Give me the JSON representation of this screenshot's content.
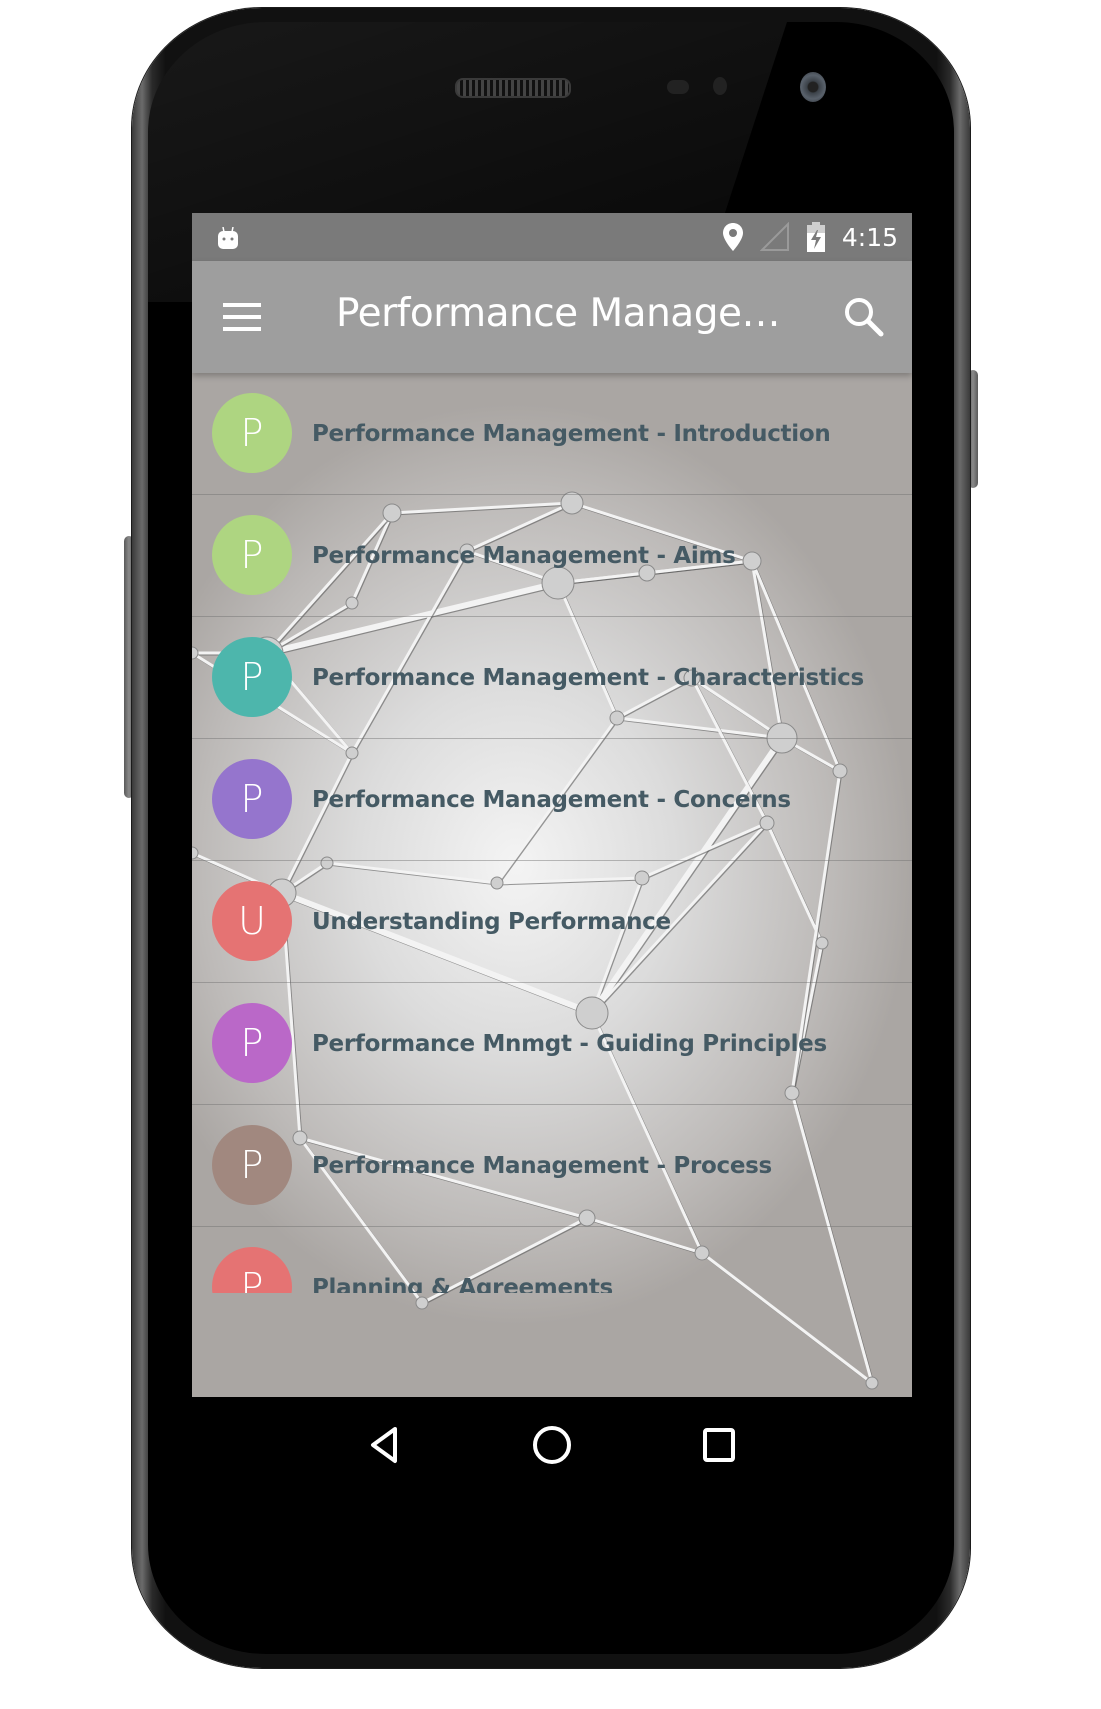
{
  "status_bar": {
    "left_icon": "android-debug-icon",
    "icons": [
      "location-icon",
      "signal-icon",
      "battery-charging-icon"
    ],
    "time": "4:15"
  },
  "toolbar": {
    "menu_icon": "hamburger-menu-icon",
    "title": "Performance Management",
    "search_icon": "search-icon"
  },
  "list": {
    "items": [
      {
        "initial": "P",
        "label": "Performance Management - Introduction",
        "color": "#aed581"
      },
      {
        "initial": "P",
        "label": "Performance Management - Aims",
        "color": "#aed581"
      },
      {
        "initial": "P",
        "label": "Performance Management - Characteristics",
        "color": "#4db6ac"
      },
      {
        "initial": "P",
        "label": "Performance Management - Concerns",
        "color": "#9575cd"
      },
      {
        "initial": "U",
        "label": "Understanding Performance",
        "color": "#e57373"
      },
      {
        "initial": "P",
        "label": "Performance Mnmgt - Guiding Principles",
        "color": "#ba68c8"
      },
      {
        "initial": "P",
        "label": "Performance Management - Process",
        "color": "#a1887f"
      },
      {
        "initial": "P",
        "label": "Planning & Agreements",
        "color": "#e57373"
      }
    ]
  },
  "nav_bar": {
    "back": "back-icon",
    "home": "home-icon",
    "recents": "recents-icon"
  },
  "theme": {
    "status_bar_bg": "#7a7a7a",
    "toolbar_bg": "#9e9e9e",
    "item_text": "#455a64"
  }
}
